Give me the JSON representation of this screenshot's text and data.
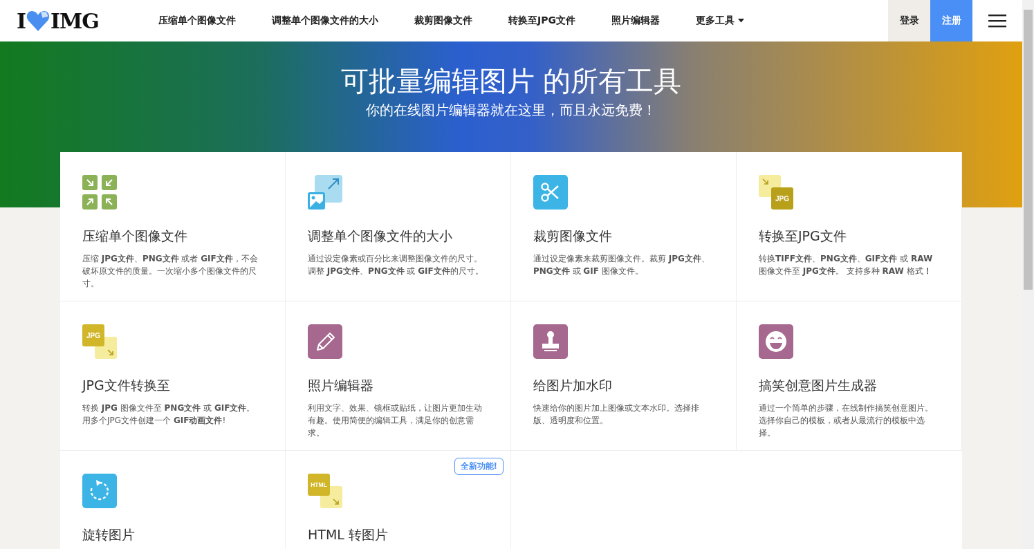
{
  "header": {
    "logo": {
      "left": "I",
      "right": "IMG"
    },
    "nav": [
      {
        "label": "压缩单个图像文件",
        "dropdown": false
      },
      {
        "label": "调整单个图像文件的大小",
        "dropdown": false
      },
      {
        "label": "裁剪图像文件",
        "dropdown": false
      },
      {
        "label": "转换至JPG文件",
        "dropdown": false
      },
      {
        "label": "照片编辑器",
        "dropdown": false
      },
      {
        "label": "更多工具",
        "dropdown": true
      }
    ],
    "login": "登录",
    "signup": "注册"
  },
  "hero": {
    "title": "可批量编辑图片 的所有工具",
    "subtitle": "你的在线图片编辑器就在这里，而且永远免费！"
  },
  "tools": [
    {
      "kind": "compress",
      "title": "压缩单个图像文件",
      "description": "压缩 **JPG文件**、**PNG文件** 或者 **GIF文件**，不会破坏原文件的质量。一次缩小多个图像文件的尺寸。"
    },
    {
      "kind": "resize",
      "title": "调整单个图像文件的大小",
      "description": "通过设定像素或百分比来调整图像文件的尺寸。调整 **JPG文件**、**PNG文件** 或 **GIF文件**的尺寸。"
    },
    {
      "kind": "crop",
      "title": "裁剪图像文件",
      "description": "通过设定像素来裁剪图像文件。裁剪 **JPG文件**、**PNG文件** 或 **GIF** 图像文件。"
    },
    {
      "kind": "to-jpg",
      "title": "转换至JPG文件",
      "description": "转换**TIFF文件**、**PNG文件**、**GIF文件** 或 **RAW** 图像文件至 **JPG文件**。 支持多种 **RAW** 格式**！**",
      "icon_text": "JPG"
    },
    {
      "kind": "from-jpg",
      "title": "JPG文件转换至",
      "description": "转换 **JPG** 图像文件至 **PNG文件** 或 **GIF文件**。用多个JPG文件创建一个 **GIF动画文件**!",
      "icon_text": "JPG"
    },
    {
      "kind": "edit",
      "title": "照片编辑器",
      "description": "利用文字、效果、镜框或贴纸，让图片更加生动有趣。使用简便的编辑工具，满足你的创意需求。"
    },
    {
      "kind": "watermark",
      "title": "给图片加水印",
      "description": "快速给你的图片加上图像或文本水印。选择排版、透明度和位置。"
    },
    {
      "kind": "meme",
      "title": "搞笑创意图片生成器",
      "description": "通过一个简单的步骤，在线制作搞笑创意图片。选择你自己的模板，或者从最流行的模板中选择。"
    },
    {
      "kind": "rotate",
      "title": "旋转图片"
    },
    {
      "kind": "html",
      "title": "HTML 转图片",
      "icon_text": "HTML",
      "badge": "全新功能!"
    }
  ]
}
